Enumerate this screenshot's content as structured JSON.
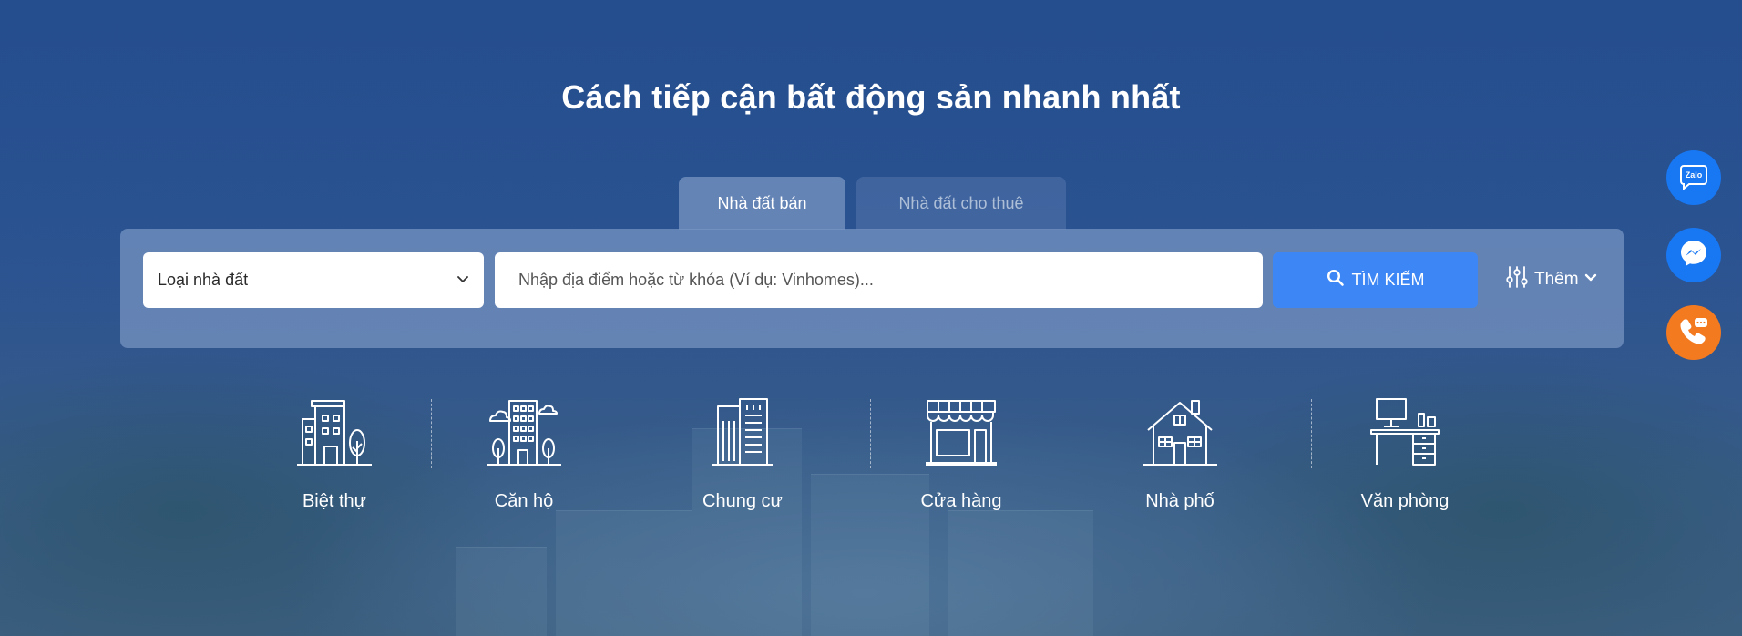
{
  "hero": {
    "title": "Cách tiếp cận bất động sản nhanh nhất"
  },
  "tabs": [
    {
      "label": "Nhà đất bán",
      "active": true
    },
    {
      "label": "Nhà đất cho thuê",
      "active": false
    }
  ],
  "search": {
    "property_type_value": "Loại nhà đất",
    "placeholder": "Nhập địa điểm hoặc từ khóa (Ví dụ: Vinhomes)...",
    "button_label": "TÌM KIẾM",
    "more_label": "Thêm"
  },
  "categories": [
    {
      "label": "Biệt thự",
      "icon": "villa-icon"
    },
    {
      "label": "Căn hộ",
      "icon": "apartment-icon"
    },
    {
      "label": "Chung cư",
      "icon": "condominium-icon"
    },
    {
      "label": "Cửa hàng",
      "icon": "shop-icon"
    },
    {
      "label": "Nhà phố",
      "icon": "townhouse-icon"
    },
    {
      "label": "Văn phòng",
      "icon": "office-icon"
    }
  ],
  "floating": {
    "zalo_label": "Zalo"
  },
  "colors": {
    "accent": "#3d86f5",
    "zalo": "#1877f2",
    "messenger": "#1877f2",
    "phone": "#f47a20"
  }
}
